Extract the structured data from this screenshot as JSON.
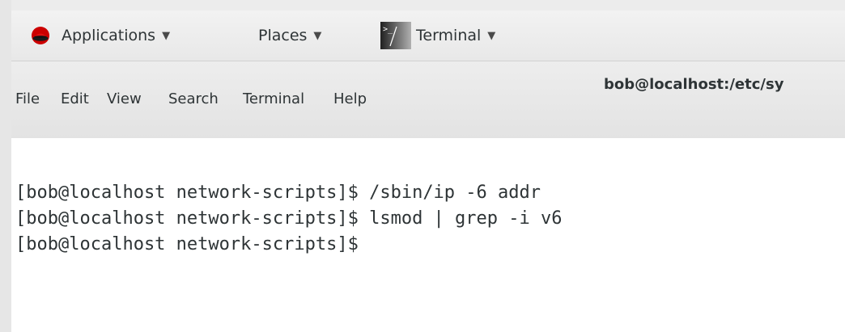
{
  "panel": {
    "applications_label": "Applications",
    "places_label": "Places",
    "terminal_label": "Terminal",
    "dropdown_glyph": "▼",
    "icons": {
      "applications": "redhat-shadowman-icon",
      "terminal": "terminal-app-icon"
    }
  },
  "window": {
    "title": "bob@localhost:/etc/sy"
  },
  "menubar": {
    "items": [
      "File",
      "Edit",
      "View",
      "Search",
      "Terminal",
      "Help"
    ]
  },
  "terminal": {
    "lines": [
      "[bob@localhost network-scripts]$ /sbin/ip -6 addr",
      "[bob@localhost network-scripts]$ lsmod | grep -i v6",
      "[bob@localhost network-scripts]$"
    ]
  },
  "colors": {
    "panel_bg": "#ececec",
    "text": "#2e3436",
    "terminal_bg": "#ffffff",
    "redhat_red": "#cc0000"
  }
}
